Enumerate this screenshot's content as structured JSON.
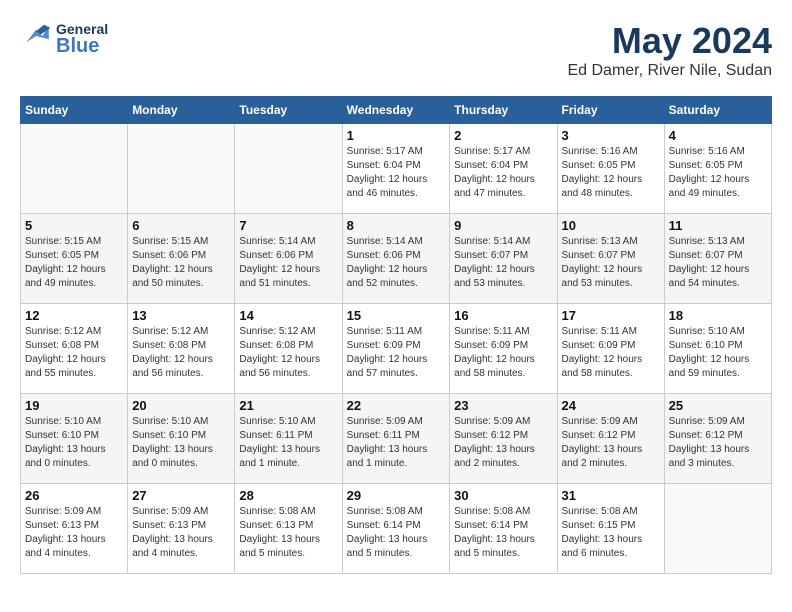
{
  "header": {
    "logo_general": "General",
    "logo_blue": "Blue",
    "month": "May 2024",
    "location": "Ed Damer, River Nile, Sudan"
  },
  "weekdays": [
    "Sunday",
    "Monday",
    "Tuesday",
    "Wednesday",
    "Thursday",
    "Friday",
    "Saturday"
  ],
  "weeks": [
    [
      {
        "day": "",
        "info": ""
      },
      {
        "day": "",
        "info": ""
      },
      {
        "day": "",
        "info": ""
      },
      {
        "day": "1",
        "info": "Sunrise: 5:17 AM\nSunset: 6:04 PM\nDaylight: 12 hours\nand 46 minutes."
      },
      {
        "day": "2",
        "info": "Sunrise: 5:17 AM\nSunset: 6:04 PM\nDaylight: 12 hours\nand 47 minutes."
      },
      {
        "day": "3",
        "info": "Sunrise: 5:16 AM\nSunset: 6:05 PM\nDaylight: 12 hours\nand 48 minutes."
      },
      {
        "day": "4",
        "info": "Sunrise: 5:16 AM\nSunset: 6:05 PM\nDaylight: 12 hours\nand 49 minutes."
      }
    ],
    [
      {
        "day": "5",
        "info": "Sunrise: 5:15 AM\nSunset: 6:05 PM\nDaylight: 12 hours\nand 49 minutes."
      },
      {
        "day": "6",
        "info": "Sunrise: 5:15 AM\nSunset: 6:06 PM\nDaylight: 12 hours\nand 50 minutes."
      },
      {
        "day": "7",
        "info": "Sunrise: 5:14 AM\nSunset: 6:06 PM\nDaylight: 12 hours\nand 51 minutes."
      },
      {
        "day": "8",
        "info": "Sunrise: 5:14 AM\nSunset: 6:06 PM\nDaylight: 12 hours\nand 52 minutes."
      },
      {
        "day": "9",
        "info": "Sunrise: 5:14 AM\nSunset: 6:07 PM\nDaylight: 12 hours\nand 53 minutes."
      },
      {
        "day": "10",
        "info": "Sunrise: 5:13 AM\nSunset: 6:07 PM\nDaylight: 12 hours\nand 53 minutes."
      },
      {
        "day": "11",
        "info": "Sunrise: 5:13 AM\nSunset: 6:07 PM\nDaylight: 12 hours\nand 54 minutes."
      }
    ],
    [
      {
        "day": "12",
        "info": "Sunrise: 5:12 AM\nSunset: 6:08 PM\nDaylight: 12 hours\nand 55 minutes."
      },
      {
        "day": "13",
        "info": "Sunrise: 5:12 AM\nSunset: 6:08 PM\nDaylight: 12 hours\nand 56 minutes."
      },
      {
        "day": "14",
        "info": "Sunrise: 5:12 AM\nSunset: 6:08 PM\nDaylight: 12 hours\nand 56 minutes."
      },
      {
        "day": "15",
        "info": "Sunrise: 5:11 AM\nSunset: 6:09 PM\nDaylight: 12 hours\nand 57 minutes."
      },
      {
        "day": "16",
        "info": "Sunrise: 5:11 AM\nSunset: 6:09 PM\nDaylight: 12 hours\nand 58 minutes."
      },
      {
        "day": "17",
        "info": "Sunrise: 5:11 AM\nSunset: 6:09 PM\nDaylight: 12 hours\nand 58 minutes."
      },
      {
        "day": "18",
        "info": "Sunrise: 5:10 AM\nSunset: 6:10 PM\nDaylight: 12 hours\nand 59 minutes."
      }
    ],
    [
      {
        "day": "19",
        "info": "Sunrise: 5:10 AM\nSunset: 6:10 PM\nDaylight: 13 hours\nand 0 minutes."
      },
      {
        "day": "20",
        "info": "Sunrise: 5:10 AM\nSunset: 6:10 PM\nDaylight: 13 hours\nand 0 minutes."
      },
      {
        "day": "21",
        "info": "Sunrise: 5:10 AM\nSunset: 6:11 PM\nDaylight: 13 hours\nand 1 minute."
      },
      {
        "day": "22",
        "info": "Sunrise: 5:09 AM\nSunset: 6:11 PM\nDaylight: 13 hours\nand 1 minute."
      },
      {
        "day": "23",
        "info": "Sunrise: 5:09 AM\nSunset: 6:12 PM\nDaylight: 13 hours\nand 2 minutes."
      },
      {
        "day": "24",
        "info": "Sunrise: 5:09 AM\nSunset: 6:12 PM\nDaylight: 13 hours\nand 2 minutes."
      },
      {
        "day": "25",
        "info": "Sunrise: 5:09 AM\nSunset: 6:12 PM\nDaylight: 13 hours\nand 3 minutes."
      }
    ],
    [
      {
        "day": "26",
        "info": "Sunrise: 5:09 AM\nSunset: 6:13 PM\nDaylight: 13 hours\nand 4 minutes."
      },
      {
        "day": "27",
        "info": "Sunrise: 5:09 AM\nSunset: 6:13 PM\nDaylight: 13 hours\nand 4 minutes."
      },
      {
        "day": "28",
        "info": "Sunrise: 5:08 AM\nSunset: 6:13 PM\nDaylight: 13 hours\nand 5 minutes."
      },
      {
        "day": "29",
        "info": "Sunrise: 5:08 AM\nSunset: 6:14 PM\nDaylight: 13 hours\nand 5 minutes."
      },
      {
        "day": "30",
        "info": "Sunrise: 5:08 AM\nSunset: 6:14 PM\nDaylight: 13 hours\nand 5 minutes."
      },
      {
        "day": "31",
        "info": "Sunrise: 5:08 AM\nSunset: 6:15 PM\nDaylight: 13 hours\nand 6 minutes."
      },
      {
        "day": "",
        "info": ""
      }
    ]
  ]
}
